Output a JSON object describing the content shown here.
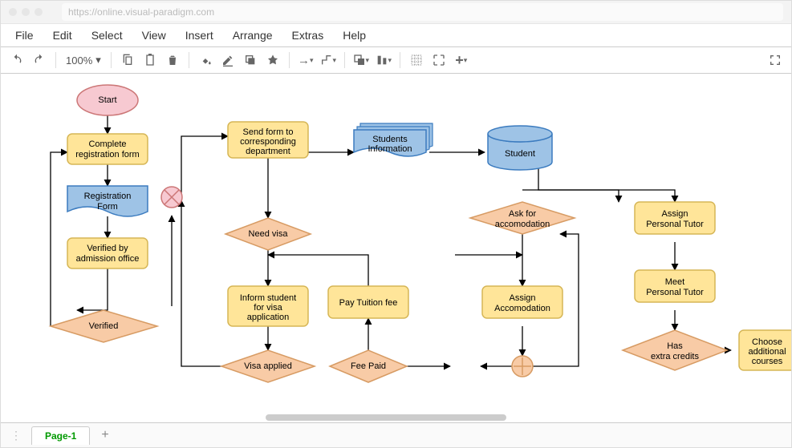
{
  "url": "https://online.visual-paradigm.com",
  "menu": [
    "File",
    "Edit",
    "Select",
    "View",
    "Insert",
    "Arrange",
    "Extras",
    "Help"
  ],
  "zoom": "100%",
  "pageTab": "Page-1",
  "colors": {
    "pink": "#f7c9d1",
    "pinkStroke": "#c77",
    "yellow": "#ffe599",
    "yellowStroke": "#d6b656",
    "blue": "#9ec3e6",
    "blueStroke": "#3b7bbf",
    "orange": "#f8cba6",
    "orangeStroke": "#d79b63"
  },
  "nodes": {
    "start": "Start",
    "complete": "Complete registration form",
    "regform": "Registration Form",
    "verifiedBy": "Verified by admission office",
    "verifiedQ": "Verified",
    "send": "Send form to corresponding department",
    "studentsInfo": "Students Information",
    "studentDb": "Student",
    "needVisa": "Need visa",
    "inform": "Inform student for visa application",
    "visaApplied": "Visa applied",
    "payTuition": "Pay Tuition fee",
    "feePaid": "Fee Paid",
    "askAccom": "Ask for accomodation",
    "assignAccom": "Assign Accomodation",
    "assignTutor": "Assign Personal Tutor",
    "meetTutor": "Meet Personal Tutor",
    "hasCredits": "Has extra credits",
    "choose": "Choose additional courses"
  }
}
